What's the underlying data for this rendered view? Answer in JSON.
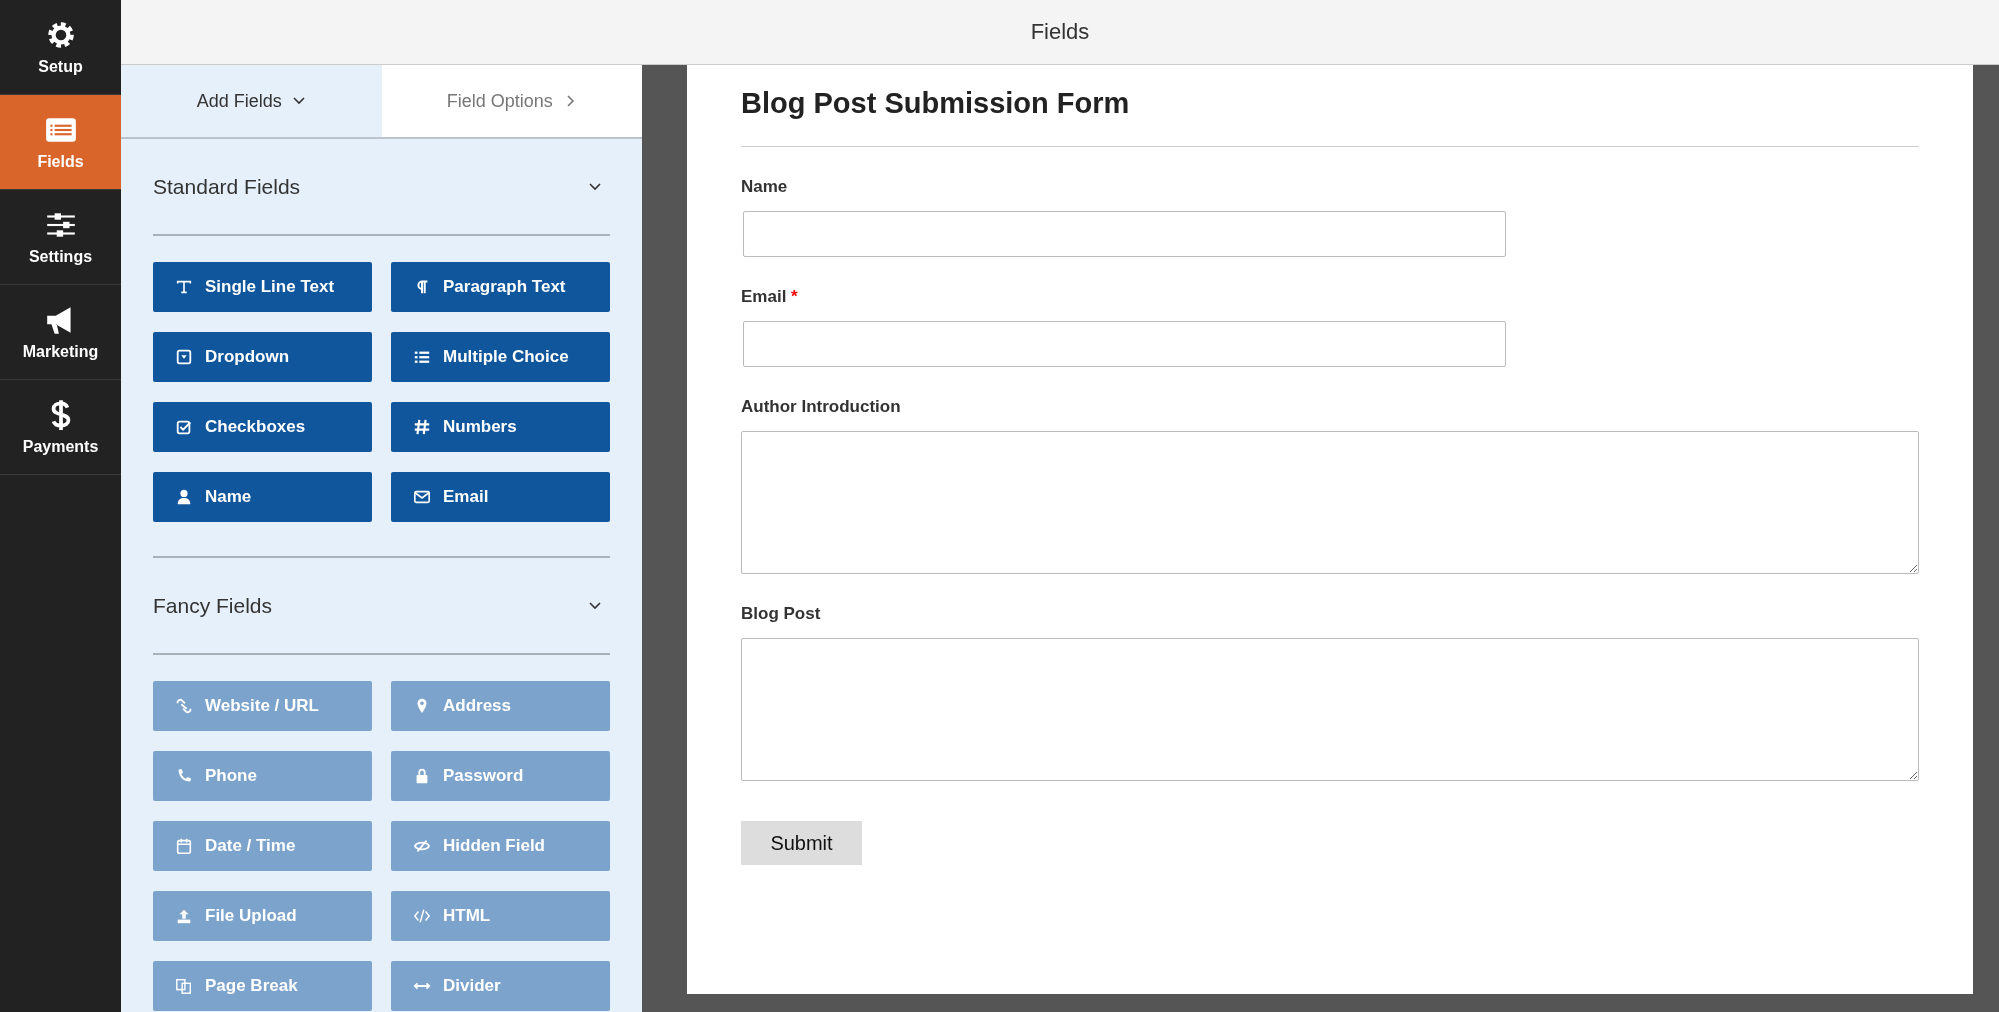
{
  "nav": [
    {
      "label": "Setup",
      "selected": false
    },
    {
      "label": "Fields",
      "selected": true
    },
    {
      "label": "Settings",
      "selected": false
    },
    {
      "label": "Marketing",
      "selected": false
    },
    {
      "label": "Payments",
      "selected": false
    }
  ],
  "top_bar": {
    "title": "Fields"
  },
  "tabs": [
    {
      "label": "Add Fields",
      "selected": true
    },
    {
      "label": "Field Options",
      "selected": false
    }
  ],
  "sections": [
    {
      "title": "Standard Fields",
      "expanded": true,
      "disabled": false,
      "buttons": [
        "Single Line Text",
        "Paragraph Text",
        "Dropdown",
        "Multiple Choice",
        "Checkboxes",
        "Numbers",
        "Name",
        "Email"
      ]
    },
    {
      "title": "Fancy Fields",
      "expanded": true,
      "disabled": true,
      "buttons": [
        "Website / URL",
        "Address",
        "Phone",
        "Password",
        "Date / Time",
        "Hidden Field",
        "File Upload",
        "HTML",
        "Page Break",
        "Divider"
      ]
    }
  ],
  "form": {
    "title": "Blog Post Submission Form",
    "fields": [
      {
        "label": "Name",
        "kind": "input",
        "required": false
      },
      {
        "label": "Email",
        "kind": "input",
        "required": true
      },
      {
        "label": "Author Introduction",
        "kind": "textarea",
        "required": false
      },
      {
        "label": "Blog Post",
        "kind": "textarea",
        "required": false
      }
    ],
    "required_mark": "*",
    "submit": "Submit"
  }
}
